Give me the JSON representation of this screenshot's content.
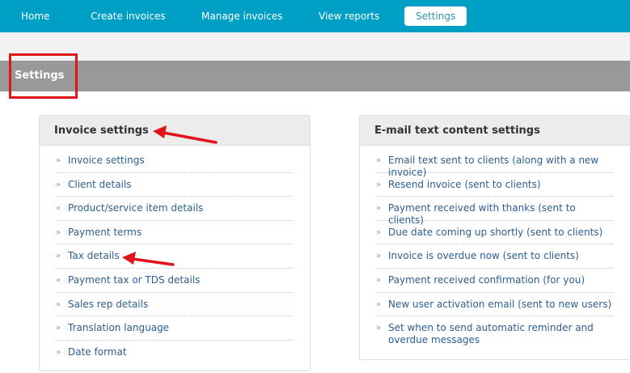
{
  "nav": {
    "items": [
      {
        "label": "Home"
      },
      {
        "label": "Create invoices"
      },
      {
        "label": "Manage invoices"
      },
      {
        "label": "View reports"
      },
      {
        "label": "Settings"
      }
    ],
    "active": "Settings"
  },
  "page": {
    "title": "Settings"
  },
  "invoice_panel": {
    "title": "Invoice settings",
    "items": [
      "Invoice settings",
      "Client details",
      "Product/service item details",
      "Payment terms",
      "Tax details",
      "Payment tax or TDS details",
      "Sales rep details",
      "Translation language",
      "Date format"
    ]
  },
  "email_panel": {
    "title": "E-mail text content settings",
    "items": [
      "Email text sent to clients (along with a new invoice)",
      "Resend invoice (sent to clients)",
      "Payment received with thanks (sent to clients)",
      "Due date coming up shortly (sent to clients)",
      "Invoice is overdue now (sent to clients)",
      "Payment received confirmation (for you)",
      "New user activation email (sent to new users)",
      "Set when to send automatic reminder and overdue messages"
    ]
  },
  "colors": {
    "nav_bg": "#00a0c6",
    "title_bar": "#999999",
    "link": "#2a5f95",
    "annotation": "#e0141a"
  }
}
